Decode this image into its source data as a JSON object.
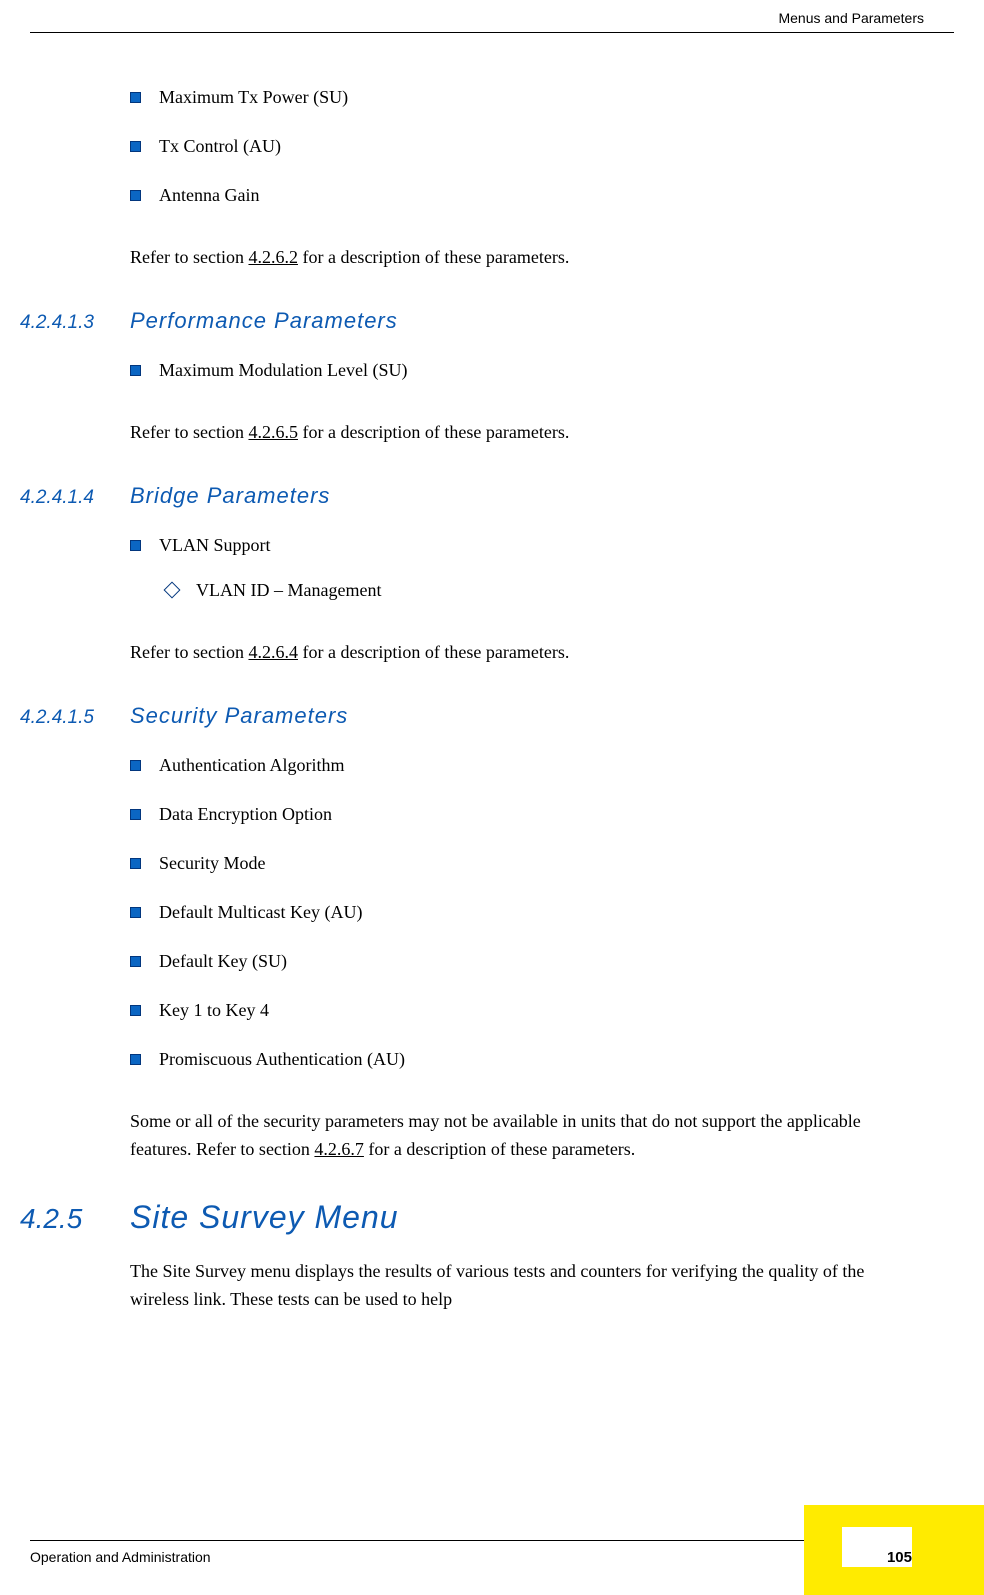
{
  "header": {
    "title": "Menus and Parameters"
  },
  "bullets_top": [
    "Maximum Tx Power (SU)",
    "Tx Control (AU)",
    "Antenna Gain"
  ],
  "refer1": {
    "prefix": "Refer to section ",
    "link": "4.2.6.2",
    "suffix": " for a description of these parameters."
  },
  "sec3": {
    "num": "4.2.4.1.3",
    "title": "Performance Parameters"
  },
  "bullets_perf": [
    "Maximum Modulation Level (SU)"
  ],
  "refer2": {
    "prefix": "Refer to section ",
    "link": "4.2.6.5",
    "suffix": " for a description of these parameters."
  },
  "sec4": {
    "num": "4.2.4.1.4",
    "title": "Bridge Parameters"
  },
  "bullets_bridge": [
    "VLAN Support"
  ],
  "sub_bridge": [
    "VLAN ID – Management"
  ],
  "refer3": {
    "prefix": "Refer to section ",
    "link": "4.2.6.4",
    "suffix": " for a description of these parameters."
  },
  "sec5": {
    "num": "4.2.4.1.5",
    "title": "Security Parameters"
  },
  "bullets_sec": [
    "Authentication Algorithm",
    "Data Encryption Option",
    "Security Mode",
    "Default Multicast Key (AU)",
    "Default Key (SU)",
    "Key 1 to Key 4",
    "Promiscuous Authentication (AU)"
  ],
  "refer4": {
    "prefix": "Some or all of the security parameters may not be available in units that do not support the applicable features. Refer to section ",
    "link": "4.2.6.7",
    "suffix": " for a description of these parameters."
  },
  "sec_425": {
    "num": "4.2.5",
    "title": "Site Survey Menu"
  },
  "para425": "The Site Survey menu displays the results of various tests and counters for verifying the quality of the wireless link. These tests can be used to help",
  "footer": {
    "left": "Operation and Administration",
    "page": "105"
  }
}
